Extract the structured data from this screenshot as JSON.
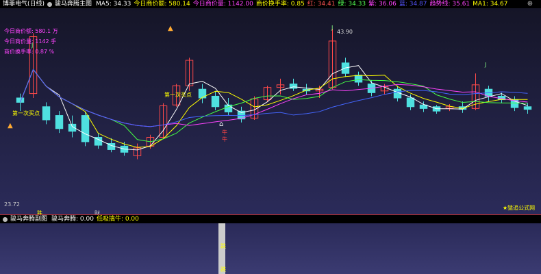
{
  "header": {
    "title": "博菲电气(日线)",
    "indicator": "骏马奔腾主图",
    "items": [
      {
        "label": "MA5: 34.33",
        "color": "#ffffff"
      },
      {
        "label": "今日商价额: 580.14",
        "color": "#ffff00"
      },
      {
        "label": "今日商价量: 1142.00",
        "color": "#ff44ff"
      },
      {
        "label": "商价换手率: 0.85",
        "color": "#ffff00"
      },
      {
        "label": "红: 34.41",
        "color": "#ff5555"
      },
      {
        "label": "绿: 34.33",
        "color": "#55ff55"
      },
      {
        "label": "紫: 36.06",
        "color": "#ff44ff"
      },
      {
        "label": "蓝: 34.87",
        "color": "#5555ff"
      },
      {
        "label": "趋势线: 35.61",
        "color": "#ff44ff"
      },
      {
        "label": "MA1: 34.67",
        "color": "#ffff00"
      }
    ]
  },
  "legend": {
    "line1": "今日商价额: 580.1 万",
    "line2": "今日商价量: 1142 手",
    "line3": "商价换手率: 0.87 %"
  },
  "annotations": {
    "high": "43.90",
    "low": "23.72",
    "first_buy_left": "第一次买点",
    "first_buy_mid": "第一次买点",
    "j1": "J",
    "j2": "J",
    "j3": "J",
    "bull_a": "牛",
    "bull_b": "牛",
    "sig_a": "跌",
    "sig_b": "财",
    "watermark": "★猛追公式网"
  },
  "subheader": {
    "indicator": "骏马奔腾副图",
    "items": [
      {
        "label": "骏马奔腾: 0.00",
        "color": "#ffffff"
      },
      {
        "label": "低吸擒牛: 0.00",
        "color": "#ffff00"
      }
    ]
  },
  "chart_data": {
    "type": "candlestick",
    "price_range": [
      23.72,
      43.9
    ],
    "candles": [
      {
        "o": 36,
        "h": 36.5,
        "l": 34.5,
        "c": 35.5
      },
      {
        "o": 36.5,
        "h": 43.4,
        "l": 36,
        "c": 43
      },
      {
        "o": 35,
        "h": 35.5,
        "l": 33,
        "c": 33.5
      },
      {
        "o": 34,
        "h": 34.5,
        "l": 32,
        "c": 32.5
      },
      {
        "o": 33,
        "h": 34,
        "l": 31.5,
        "c": 32.2
      },
      {
        "o": 34,
        "h": 34.4,
        "l": 30.5,
        "c": 31
      },
      {
        "o": 31.5,
        "h": 32,
        "l": 30.2,
        "c": 30.6
      },
      {
        "o": 30.8,
        "h": 31.4,
        "l": 29.8,
        "c": 30.1
      },
      {
        "o": 30.5,
        "h": 31,
        "l": 29.4,
        "c": 29.8
      },
      {
        "o": 29.4,
        "h": 30.8,
        "l": 29,
        "c": 30.3
      },
      {
        "o": 30.5,
        "h": 31.8,
        "l": 30.2,
        "c": 31.5
      },
      {
        "o": 31.5,
        "h": 35.4,
        "l": 31.3,
        "c": 35.1
      },
      {
        "o": 35.2,
        "h": 37.6,
        "l": 35,
        "c": 37.4
      },
      {
        "o": 37.4,
        "h": 40.6,
        "l": 36.8,
        "c": 40.3
      },
      {
        "o": 37,
        "h": 37.6,
        "l": 35.4,
        "c": 36
      },
      {
        "o": 36.2,
        "h": 36.8,
        "l": 34.6,
        "c": 35
      },
      {
        "o": 35.2,
        "h": 36,
        "l": 34,
        "c": 34.4
      },
      {
        "o": 34.5,
        "h": 35,
        "l": 33.2,
        "c": 33.6
      },
      {
        "o": 33.7,
        "h": 36.2,
        "l": 33.5,
        "c": 35.9
      },
      {
        "o": 35.8,
        "h": 37.4,
        "l": 35.6,
        "c": 37.2
      },
      {
        "o": 37.2,
        "h": 38.2,
        "l": 36.4,
        "c": 37.5
      },
      {
        "o": 37.6,
        "h": 38.2,
        "l": 36.8,
        "c": 37.1
      },
      {
        "o": 37,
        "h": 37.6,
        "l": 36.4,
        "c": 36.8
      },
      {
        "o": 36.8,
        "h": 37.4,
        "l": 36,
        "c": 37
      },
      {
        "o": 37.2,
        "h": 43.9,
        "l": 37,
        "c": 42.5
      },
      {
        "o": 40,
        "h": 40.6,
        "l": 38.4,
        "c": 38.8
      },
      {
        "o": 38.6,
        "h": 39,
        "l": 37.4,
        "c": 37.8
      },
      {
        "o": 37.6,
        "h": 38,
        "l": 36.2,
        "c": 36.6
      },
      {
        "o": 36.8,
        "h": 37.6,
        "l": 36.4,
        "c": 37.3
      },
      {
        "o": 37,
        "h": 37.4,
        "l": 35.6,
        "c": 36
      },
      {
        "o": 36,
        "h": 36.4,
        "l": 34.6,
        "c": 35
      },
      {
        "o": 35.2,
        "h": 35.6,
        "l": 34.4,
        "c": 34.8
      },
      {
        "o": 35,
        "h": 35.2,
        "l": 34.2,
        "c": 34.5
      },
      {
        "o": 34.8,
        "h": 35.3,
        "l": 34.5,
        "c": 35
      },
      {
        "o": 35,
        "h": 35.6,
        "l": 34.3,
        "c": 34.7
      },
      {
        "o": 34.8,
        "h": 38.8,
        "l": 34.6,
        "c": 37.5
      },
      {
        "o": 37,
        "h": 37.4,
        "l": 35.6,
        "c": 36.2
      },
      {
        "o": 36.2,
        "h": 36.6,
        "l": 35.4,
        "c": 35.8
      },
      {
        "o": 35.8,
        "h": 36.2,
        "l": 34.5,
        "c": 34.9
      },
      {
        "o": 35,
        "h": 35.4,
        "l": 34.2,
        "c": 34.7
      }
    ]
  }
}
